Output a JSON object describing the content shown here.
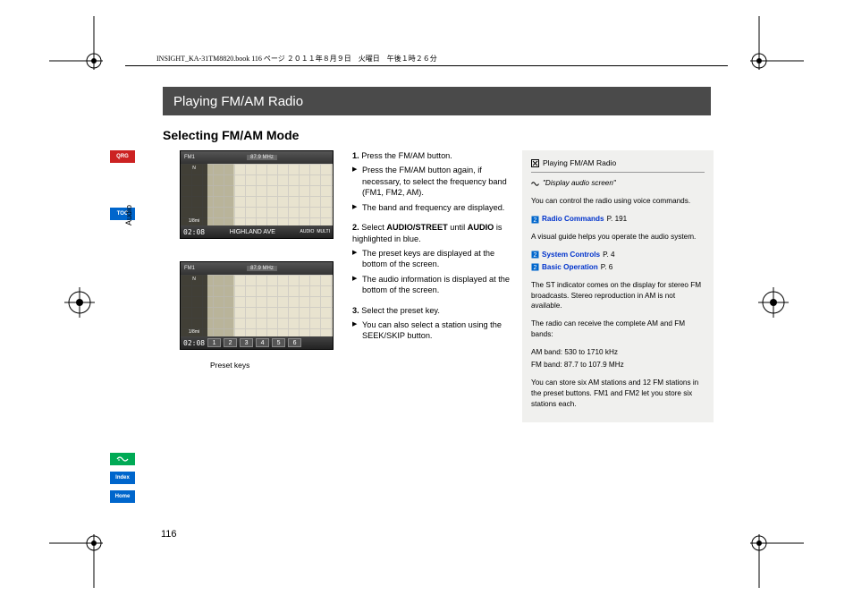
{
  "pagehead": "INSIGHT_KA-31TM8820.book  116 ページ  ２０１１年８月９日　火曜日　午後１時２６分",
  "pagenum": "116",
  "sidebar": {
    "qrg": "QRG",
    "toc": "TOC",
    "voice_icon": "voice-command-icon",
    "index": "Index",
    "home": "Home",
    "vertical": "Audio"
  },
  "title": "Playing FM/AM Radio",
  "subtitle": "Selecting FM/AM Mode",
  "shot": {
    "band": "FM1",
    "freq": "87.9 MHz",
    "scale": "1/8mi",
    "clock": "02:08",
    "street": "HIGHLAND AVE",
    "audio_btn": "AUDIO",
    "multi_btn": "MULTI",
    "north": "N",
    "presets": [
      "1",
      "2",
      "3",
      "4",
      "5",
      "6"
    ]
  },
  "caption": "Preset keys",
  "instr": {
    "s1": "Press the FM/AM button.",
    "s1a": "Press the FM/AM button again, if necessary, to select the frequency band (FM1, FM2, AM).",
    "s1b": "The band and frequency are displayed.",
    "s2_pre": "Select ",
    "s2_bold1": "AUDIO/STREET",
    "s2_mid": " until ",
    "s2_bold2": "AUDIO",
    "s2_post": " is highlighted in blue.",
    "s2a": "The preset keys are displayed at the bottom of the screen.",
    "s2b": "The audio information is displayed at the bottom of the screen.",
    "s3": "Select the preset key.",
    "s3a": "You can also select a station using the SEEK/SKIP button."
  },
  "info": {
    "hdr": "Playing FM/AM Radio",
    "quote": "\"Display audio screen\"",
    "p1": "You can control the radio using voice commands.",
    "link1": "Radio Commands",
    "link1_p": "P. 191",
    "p2": "A visual guide helps you operate the audio system.",
    "link2": "System Controls",
    "link2_p": "P. 4",
    "link3": "Basic Operation",
    "link3_p": "P. 6",
    "p3": "The ST indicator comes on the display for stereo FM broadcasts. Stereo reproduction in AM is not available.",
    "p4": "The radio can receive the complete AM and FM bands:",
    "p5a": "AM band: 530 to 1710 kHz",
    "p5b": "FM band: 87.7 to 107.9 MHz",
    "p6": "You can store six AM stations and 12 FM stations in the preset buttons. FM1 and FM2 let you store six stations each."
  }
}
